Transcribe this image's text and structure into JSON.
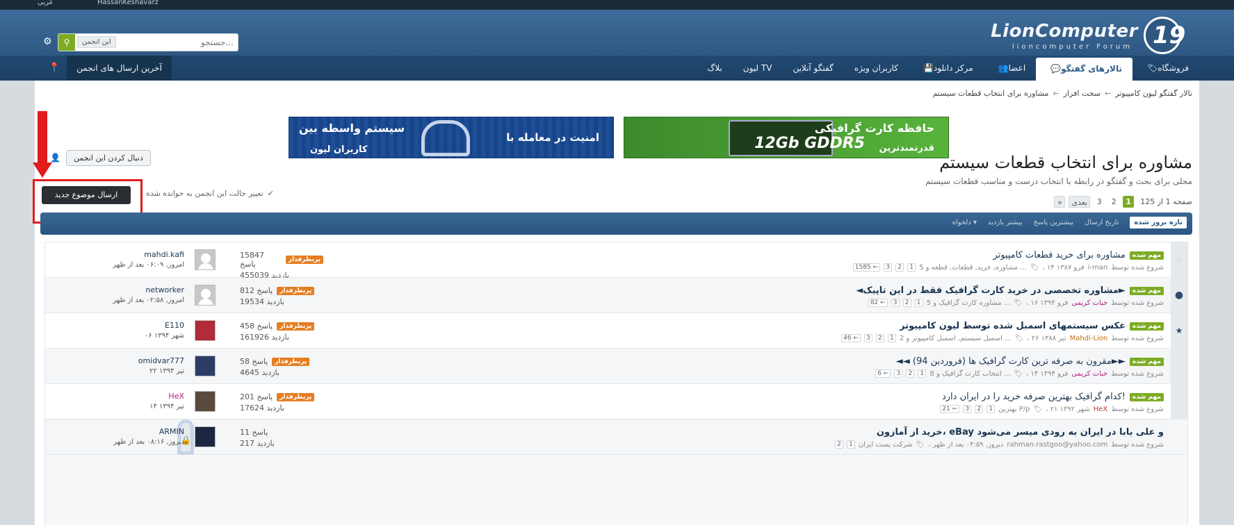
{
  "topbar": {
    "lang": "عربی",
    "user": "HassanKeshavarz"
  },
  "logo": {
    "name": "LionComputer",
    "tagline": "lioncomputer Forum",
    "mark": "19"
  },
  "search": {
    "placeholder": "جستجو...",
    "scope": "این انجمن",
    "go_icon": "search-icon",
    "settings_icon": "gear-icon"
  },
  "nav": {
    "tabs": [
      {
        "label": "فروشگاه",
        "icon": "🏷"
      },
      {
        "label": "تالارهای گفتگو",
        "icon": "💬"
      },
      {
        "label": "اعضا",
        "icon": "👥"
      },
      {
        "label": "مرکز دانلود",
        "icon": "💾"
      },
      {
        "label": "کاربران ویژه",
        "icon": ""
      },
      {
        "label": "گفتگو آنلاین",
        "icon": ""
      },
      {
        "label": "لیون TV",
        "icon": ""
      },
      {
        "label": "بلاگ",
        "icon": ""
      }
    ],
    "latest_posts": "آخرین ارسال های انجمن"
  },
  "breadcrumb": {
    "items": [
      "تالار گفتگو لیون کامپیوتر",
      "سخت افزار",
      "مشاوره برای انتخاب قطعات سیستم"
    ],
    "sep": "←"
  },
  "banners": {
    "green": {
      "line1": "حافظه کارت گرافیکی",
      "line2": "12Gb GDDR5",
      "line3": "قدرتمندترین"
    },
    "blue": {
      "line1": "سیستم واسطه بین",
      "line2": "امنیت در معامله با",
      "line3": "کاربران لیون"
    }
  },
  "forum": {
    "title": "مشاوره برای انتخاب قطعات سیستم",
    "description": "محلی برای بحث و گفتگو در رابطه با انتخاب درست و مناسب قطعات سیستم",
    "follow": "دنبال کردن این انجمن",
    "new_topic": "ارسال موضوع جدید",
    "mark_read": "تغییر حالت این انجمن به خوانده شده"
  },
  "pager": {
    "label": "صفحه 1 از 125",
    "pages": [
      "1",
      "2",
      "3"
    ],
    "next": "بعدی",
    "last": "»"
  },
  "sorts": [
    "تازه بروز شده",
    "تاریخ ارسال",
    "بیشترین پاسخ",
    "بیشتر بازدید",
    "دلخواه ▾"
  ],
  "threads": [
    {
      "status": "☆",
      "sticky": "مهم شده",
      "title": "مشاوره برای خرید قطعات کامپیوتر",
      "bold": false,
      "started": "شروع شده توسط",
      "author": "i-man",
      "date": "، ۱۴ فرو ۱۳۸۷",
      "tags": "مشاوره, خرید, قطعات, قطعه و 5 ...",
      "pages": [
        "1",
        "2",
        "3",
        "1585 ←"
      ],
      "hot": "پربطرفدار",
      "replies": "15847 پاسخ",
      "views": "455039 بازدید",
      "last_user": "mahdi.kafi",
      "last_date": "امروز, ۰۶:۰۹ بعد از ظهر"
    },
    {
      "status": "●",
      "sticky": "مهم شده",
      "title": "◄مشاوره تخصصی در خرید کارت گرافیک فقط در این تاپیک►",
      "bold": true,
      "started": "شروع شده توسط",
      "author": "خبات کریمی",
      "date": "، ۱۶ فرو ۱۳۹۴",
      "tags": "مشاوره کارت گرافیک و 5 ...",
      "pages": [
        "1",
        "2",
        "3",
        "82 ←"
      ],
      "hot": "پربطرفدار",
      "replies": "812 پاسخ",
      "views": "19534 بازدید",
      "last_user": "networker",
      "last_date": "امروز, ۰۲:۵۸ بعد از ظهر"
    },
    {
      "status": "★",
      "sticky": "مهم شده",
      "title": "عکس سیستمهای اسمبل شده توسط لیون کامپیوتر",
      "bold": true,
      "started": "شروع شده توسط",
      "author": "Mahdi-Lion",
      "date": "، ۲۶ تیر ۱۳۸۸",
      "tags": "اسمبل سیستم, اسمبل کامپیوتر و 2 ...",
      "pages": [
        "1",
        "2",
        "3",
        "46 ←"
      ],
      "hot": "پربطرفدار",
      "replies": "458 پاسخ",
      "views": "161926 بازدید",
      "last_user": "E110",
      "last_date": "۰۶ شهر ۱۳۹۴"
    },
    {
      "status": "",
      "sticky": "مهم شده",
      "title": "◄◄ مقرون به صرفه ترین کارت گرافیک ها (فروردین 94)►►",
      "bold": false,
      "started": "شروع شده توسط",
      "author": "خبات کریمی",
      "date": "، ۱۴ فرو ۱۳۹۴",
      "tags": "انتخاب کارت گرافیک و 8 ...",
      "pages": [
        "1",
        "2",
        "3",
        "6 ←"
      ],
      "hot": "پربطرفدار",
      "replies": "58 پاسخ",
      "views": "4645 بازدید",
      "last_user": "omidvar777",
      "last_date": "۲۲ تیر ۱۳۹۴"
    },
    {
      "status": "",
      "sticky": "مهم شده",
      "title": "کدام گرافیک بهترین صرفه خرید را در ایران دارد!",
      "bold": false,
      "started": "شروع شده توسط",
      "author": "HeX",
      "date": "، ۲۱ شهر ۱۳۹۲",
      "tags": "بهترین P/p",
      "pages": [
        "1",
        "2",
        "3",
        "21 ←"
      ],
      "hot": "پربطرفدار",
      "replies": "201 پاسخ",
      "views": "17624 بازدید",
      "last_user": "HeX",
      "last_date": "۱۴ تیر ۱۳۹۴"
    },
    {
      "status": "🔒",
      "sticky": "",
      "title": "خرید از آمازون، eBay و علی بابا در ایران به رودی میسر می‌شود",
      "bold": true,
      "started": "شروع شده توسط",
      "author": "rahman.rastgoo@yahoo.com",
      "date": "، دیروز, ۰۴:۵۹ بعد از ظهر",
      "tags": "شرکت پست ایران",
      "pages": [
        "1",
        "2"
      ],
      "hot": "",
      "replies": "11 پاسخ",
      "views": "217 بازدید",
      "last_user": "ARMIN",
      "last_date": "دیروز, ۰۸:۱۶ بعد از ظهر"
    }
  ]
}
